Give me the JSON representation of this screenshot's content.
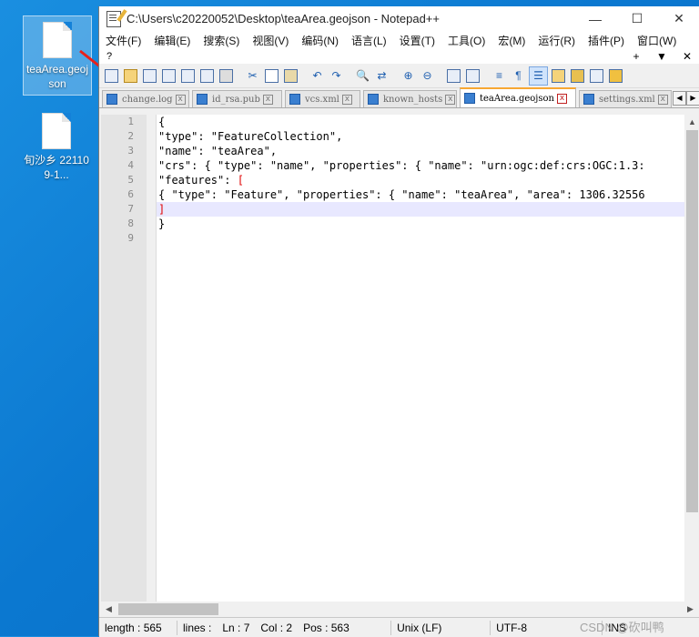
{
  "desktop": {
    "icons": [
      {
        "label": "teaArea.geojson"
      },
      {
        "label": "旬沙乡 221109-1..."
      }
    ]
  },
  "window": {
    "title": "C:\\Users\\c20220052\\Desktop\\teaArea.geojson - Notepad++",
    "controls": {
      "minimize": "—",
      "maximize": "☐",
      "close": "✕"
    }
  },
  "menu": {
    "items": [
      "文件(F)",
      "编辑(E)",
      "搜索(S)",
      "视图(V)",
      "编码(N)",
      "语言(L)",
      "设置(T)",
      "工具(O)",
      "宏(M)",
      "运行(R)",
      "插件(P)",
      "窗口(W)"
    ],
    "help": "?",
    "right": {
      "plus": "+",
      "dropdown": "▼",
      "close": "✕"
    }
  },
  "tabs": [
    {
      "label": "change.log"
    },
    {
      "label": "id_rsa.pub"
    },
    {
      "label": "vcs.xml"
    },
    {
      "label": "known_hosts"
    },
    {
      "label": "teaArea.geojson"
    },
    {
      "label": "settings.xml"
    }
  ],
  "active_tab": 4,
  "editor": {
    "line_numbers": [
      "1",
      "2",
      "3",
      "4",
      "5",
      "6",
      "7",
      "8",
      "9"
    ],
    "lines": [
      "{",
      "\"type\": \"FeatureCollection\",",
      "\"name\": \"teaArea\",",
      "\"crs\": { \"type\": \"name\", \"properties\": { \"name\": \"urn:ogc:def:crs:OGC:1.3:",
      "\"features\": [",
      "{ \"type\": \"Feature\", \"properties\": { \"name\": \"teaArea\", \"area\": 1306.32556",
      "]",
      "}",
      ""
    ],
    "current_line": 7
  },
  "status": {
    "length": "length : 565",
    "lines": "lines :",
    "ln": "Ln : 7",
    "col": "Col : 2",
    "pos": "Pos : 563",
    "eol": "Unix (LF)",
    "encoding": "UTF-8",
    "mode": "INS"
  },
  "watermark": "CSDN @砍叫鸭"
}
